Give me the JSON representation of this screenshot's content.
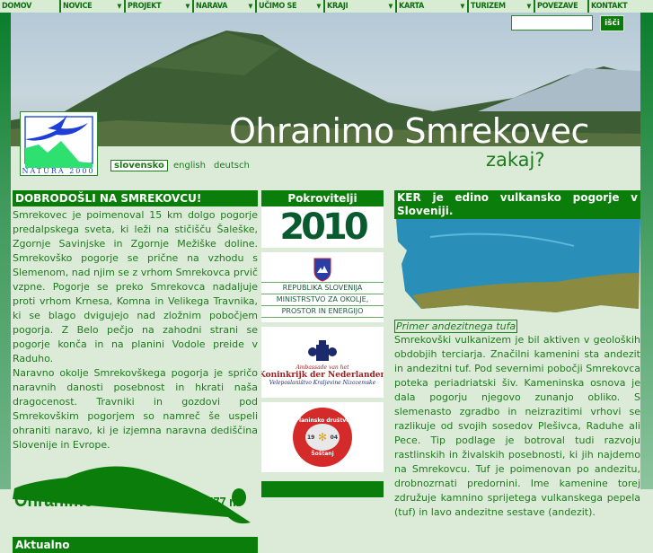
{
  "nav": [
    {
      "label": "DOMOV",
      "dd": false
    },
    {
      "label": "NOVICE",
      "dd": true
    },
    {
      "label": "PROJEKT",
      "dd": true
    },
    {
      "label": "NARAVA",
      "dd": true
    },
    {
      "label": "UČIMO SE",
      "dd": true
    },
    {
      "label": "KRAJI",
      "dd": true
    },
    {
      "label": "KARTA",
      "dd": true
    },
    {
      "label": "TURIZEM",
      "dd": true
    },
    {
      "label": "POVEZAVE",
      "dd": false
    },
    {
      "label": "KONTAKT",
      "dd": false
    }
  ],
  "search": {
    "value": "",
    "button": "išči"
  },
  "header": {
    "title": "Ohranimo Smrekovec",
    "subtitle": "zakaj?",
    "logo_text": "NATURA 2000"
  },
  "languages": [
    "slovensko",
    "english",
    "deutsch"
  ],
  "left": {
    "heading": "DOBRODOŠLI NA SMREKOVCU!",
    "p1": "Smrekovec je poimenoval 15 km dolgo pogorje predalpskega sveta, ki leži na stičišču Šaleške, Zgornje Savinjske in Zgornje Mežiške doline. Smrekovško pogorje se prične na vzhodu s Slemenom, nad njim se z vrhom Smrekovca prvič vzpne. Pogorje se preko Smrekovca nadaljuje proti vrhom Krnesa, Komna in Velikega Travnika, ki se blago dvigujejo nad zložnim pobočjem pogorja. Z Belo pečjo na zahodni strani se pogorje konča in na planini Vodole preide v Raduho.",
    "p2": "Naravno okolje Smrekovškega pogorja je spričo naravnih danosti posebnost in hkrati naša dragocenost. Travniki in gozdovi pod Smrekovškim pogorjem so namreč še uspeli ohraniti naravo, ki je izjemna naravna dediščina Slovenije in Evrope.",
    "banner": "Ohranimo Smrekovec,",
    "banner_height": "1.577 m",
    "news_heading": "Aktualno"
  },
  "middle": {
    "heading": "Pokrovitelji",
    "sponsors": {
      "year": "2010",
      "slo": [
        "REPUBLIKA SLOVENIJA",
        "MINISTRSTVO ZA OKOLJE,",
        "PROSTOR IN ENERGIJO"
      ],
      "nl_small": "Ambassade van het",
      "nl": "Koninkrijk der Nederlanden",
      "nl_sub": "Veleposlaništvo Kraljevine Nizozemske",
      "pd": "Planinsko društvo",
      "pd_year_a": "19",
      "pd_year_b": "04",
      "pd_place": "Šoštanj"
    }
  },
  "right": {
    "heading": "KER je edino vulkansko pogorje v Sloveniji.",
    "caption": "Primer andezitnega tufa",
    "text": "Smrekovški vulkanizem je bil aktiven v geoloških obdobjih terciarja. Značilni kamenini sta andezit in andezitni tuf. Pod severnimi pobočji Smrekovca poteka periadriatski šiv. Kameninska osnova je dala pogorju njegovo zunanjo obliko. S slemenasto zgradbo in neizrazitimi vrhovi se razlikuje od svojih sosedov Plešivca, Raduhe ali Pece. Tip podlage je botroval tudi razvoju rastlinskih in živalskih posebnosti, ki jih najdemo na Smrekovcu. Tuf je poimenovan po andezitu, drobnozrnati predornini. Ime kamenine torej združuje kamnino sprijetega vulkanskega pepela (tuf) in lavo andezitne sestave (andezit)."
  }
}
